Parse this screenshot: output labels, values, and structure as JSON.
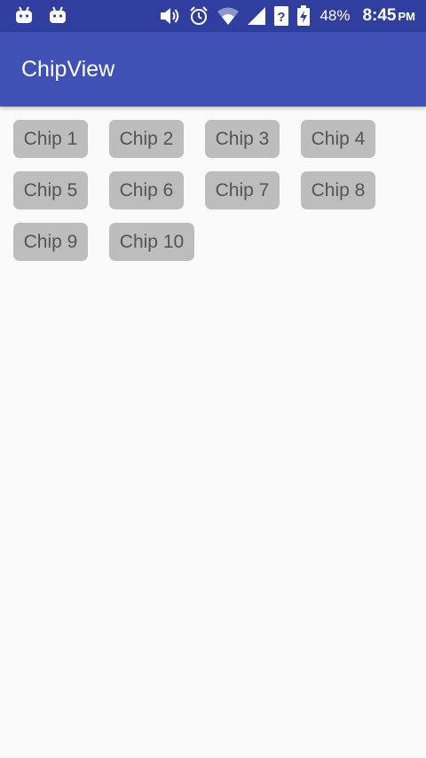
{
  "status_bar": {
    "left_icons": [
      "android-icon",
      "android-icon"
    ],
    "right_icons": [
      "volume-icon",
      "alarm-icon",
      "wifi-icon",
      "signal-icon",
      "unknown-network-icon",
      "battery-charging-icon"
    ],
    "battery": "48%",
    "time": "8:45",
    "ampm": "PM"
  },
  "app_bar": {
    "title": "ChipView",
    "color": "#3f51b5"
  },
  "chips": [
    {
      "label": "Chip 1"
    },
    {
      "label": "Chip 2"
    },
    {
      "label": "Chip 3"
    },
    {
      "label": "Chip 4"
    },
    {
      "label": "Chip 5"
    },
    {
      "label": "Chip 6"
    },
    {
      "label": "Chip 7"
    },
    {
      "label": "Chip 8"
    },
    {
      "label": "Chip 9"
    },
    {
      "label": "Chip 10"
    }
  ],
  "colors": {
    "status_bar": "#303f9f",
    "chip_background": "#bdbdbd",
    "chip_text": "#545454",
    "background": "#fafafa"
  }
}
